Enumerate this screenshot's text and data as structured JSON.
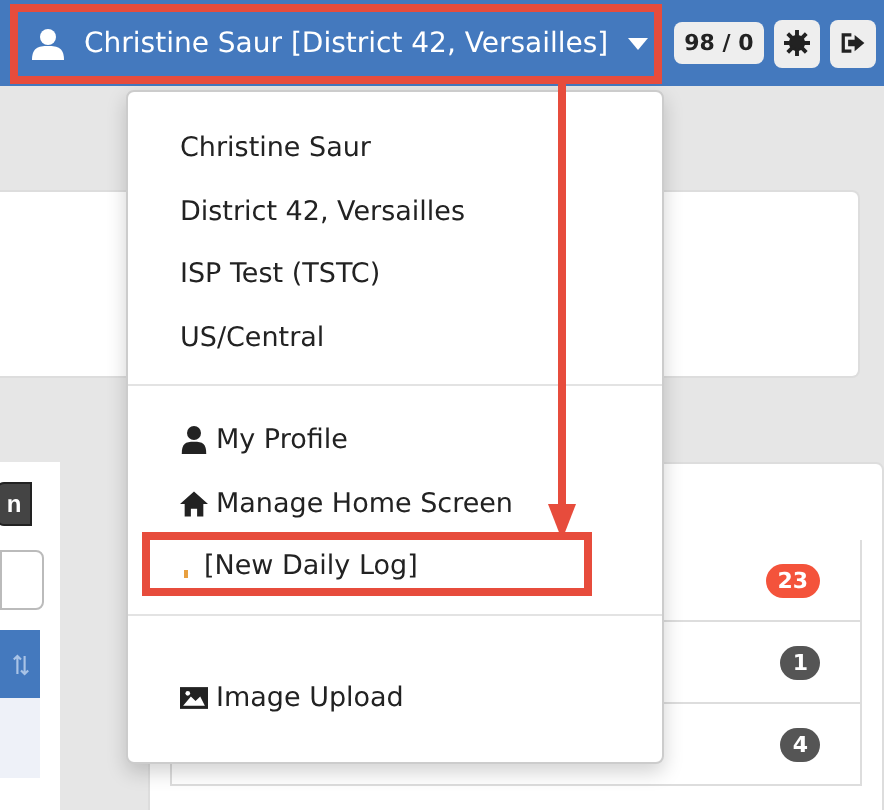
{
  "header": {
    "user": "Christine Saur [District 42, Versailles]",
    "counter": "98 / 0"
  },
  "left_panel": {
    "button": "n"
  },
  "right_panel": {
    "badges": [
      {
        "text": "23",
        "color": "#f4533b"
      },
      {
        "text": "1",
        "color": "#555555"
      },
      {
        "text": "4",
        "color": "#555555"
      }
    ]
  },
  "menu": {
    "sections": [
      {
        "items": [
          {
            "kind": "text",
            "label": "Christine Saur"
          },
          {
            "kind": "text",
            "label": "District 42, Versailles"
          },
          {
            "kind": "text",
            "label": "ISP Test (TSTC)"
          },
          {
            "kind": "text",
            "label": "US/Central"
          }
        ]
      },
      {
        "items": [
          {
            "kind": "profile",
            "label": "My Profile"
          },
          {
            "kind": "home",
            "label": "Manage Home Screen"
          },
          {
            "kind": "log",
            "label": "[New Daily Log]"
          }
        ]
      },
      {
        "items": [
          {
            "kind": "image",
            "label": "Image Upload"
          }
        ]
      }
    ]
  }
}
